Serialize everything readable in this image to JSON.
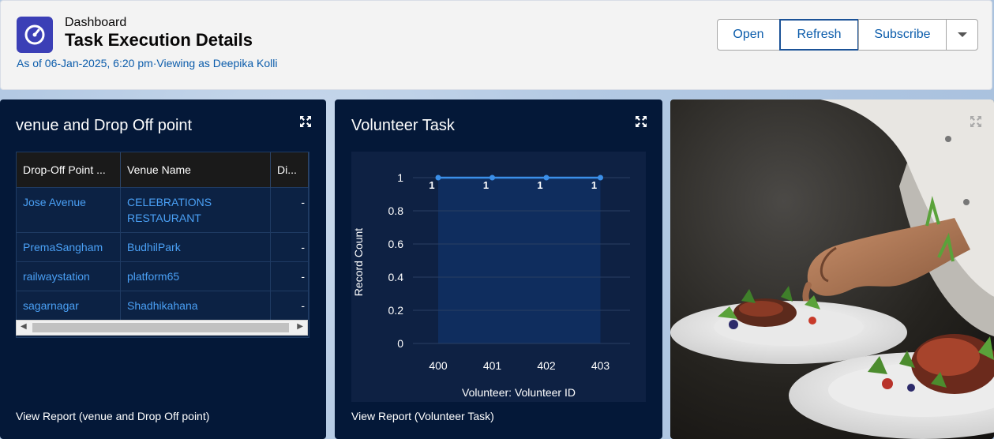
{
  "header": {
    "breadcrumb": "Dashboard",
    "title": "Task Execution Details",
    "as_of": "As of 06-Jan-2025, 6:20 pm·Viewing as Deepika Kolli",
    "buttons": {
      "open": "Open",
      "refresh": "Refresh",
      "subscribe": "Subscribe",
      "more_icon": "chevron-down-icon"
    }
  },
  "venue_panel": {
    "title": "venue and Drop Off point",
    "columns": [
      "Drop-Off Point ...",
      "Venue Name",
      "Di..."
    ],
    "rows": [
      {
        "dropoff": "Jose Avenue",
        "venue": "CELEBRATIONS RESTAURANT",
        "di": "-"
      },
      {
        "dropoff": "PremaSangham",
        "venue": "BudhilPark",
        "di": "-"
      },
      {
        "dropoff": "railwaystation",
        "venue": "platform65",
        "di": "-"
      },
      {
        "dropoff": "sagarnagar",
        "venue": "Shadhikahana",
        "di": "-"
      }
    ],
    "view_report": "View Report (venue and Drop Off point)"
  },
  "volunteer_panel": {
    "title": "Volunteer Task",
    "view_report": "View Report (Volunteer Task)"
  },
  "chart_data": {
    "type": "line",
    "categories": [
      "400",
      "401",
      "402",
      "403"
    ],
    "series": [
      {
        "values": [
          1,
          1,
          1,
          1
        ]
      }
    ],
    "data_labels": [
      "1",
      "1",
      "1",
      "1"
    ],
    "xlabel": "Volunteer: Volunteer ID",
    "ylabel": "Record Count",
    "yticks": [
      "0",
      "0.2",
      "0.4",
      "0.6",
      "0.8",
      "1"
    ],
    "ylim": [
      0,
      1
    ],
    "grid": true,
    "line_color": "#3b8fe8"
  }
}
